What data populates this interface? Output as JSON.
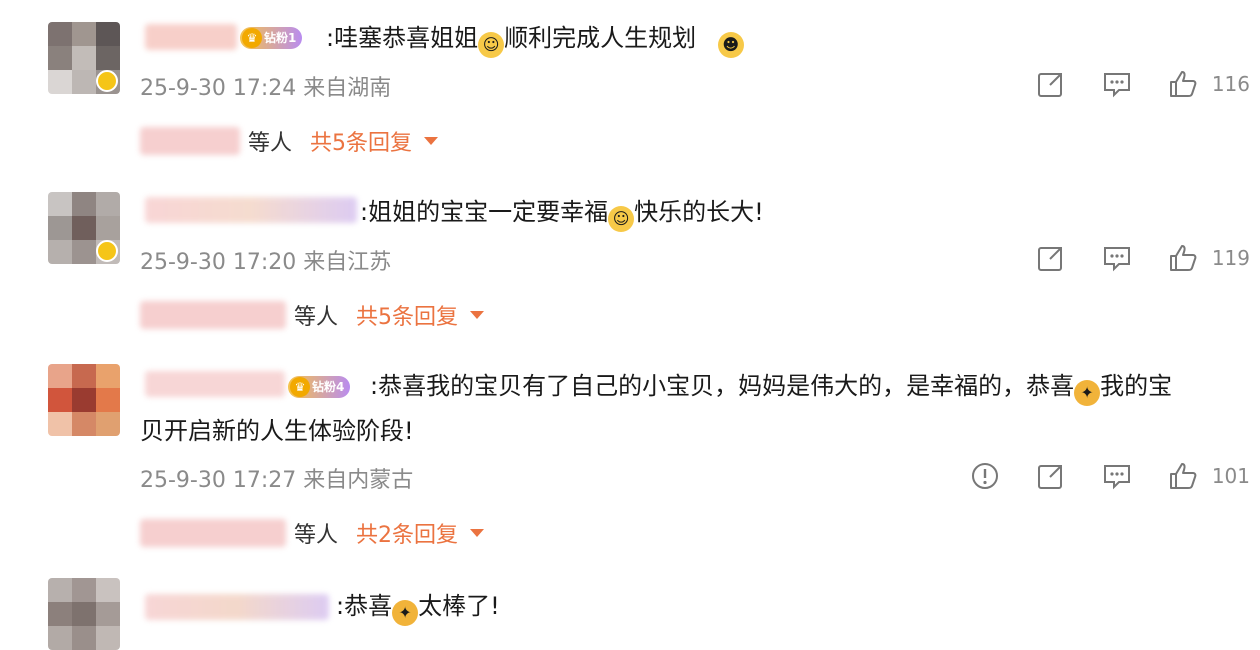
{
  "comments": [
    {
      "badge": "钻粉1",
      "text_parts": [
        ":哇塞恭喜姐姐",
        "顺利完成人生规划"
      ],
      "meta": "25-9-30 17:24 来自湖南",
      "likes": "116",
      "reply_who": "等人",
      "reply_total": "共5条回复"
    },
    {
      "badge": "",
      "text_parts": [
        ":姐姐的宝宝一定要幸福",
        "快乐的长大!"
      ],
      "meta": "25-9-30 17:20 来自江苏",
      "likes": "119",
      "reply_who": "等人",
      "reply_total": "共5条回复"
    },
    {
      "badge": "钻粉4",
      "text_line1": ":恭喜我的宝贝有了自己的小宝贝，妈妈是伟大的，是幸福的，恭喜",
      "text_line1_after": "我的宝",
      "text_line2": "贝开启新的人生体验阶段!",
      "meta": "25-9-30 17:27 来自内蒙古",
      "likes": "101",
      "reply_who": "等人",
      "reply_total": "共2条回复"
    },
    {
      "badge": "",
      "text_parts": [
        ":恭喜",
        "太棒了!"
      ]
    }
  ],
  "icons": {
    "share": "share-icon",
    "comment": "comment-icon",
    "like": "thumbs-up-icon",
    "report": "report-icon"
  },
  "colors": {
    "accent": "#eb7340",
    "meta": "#8a8a8a"
  }
}
